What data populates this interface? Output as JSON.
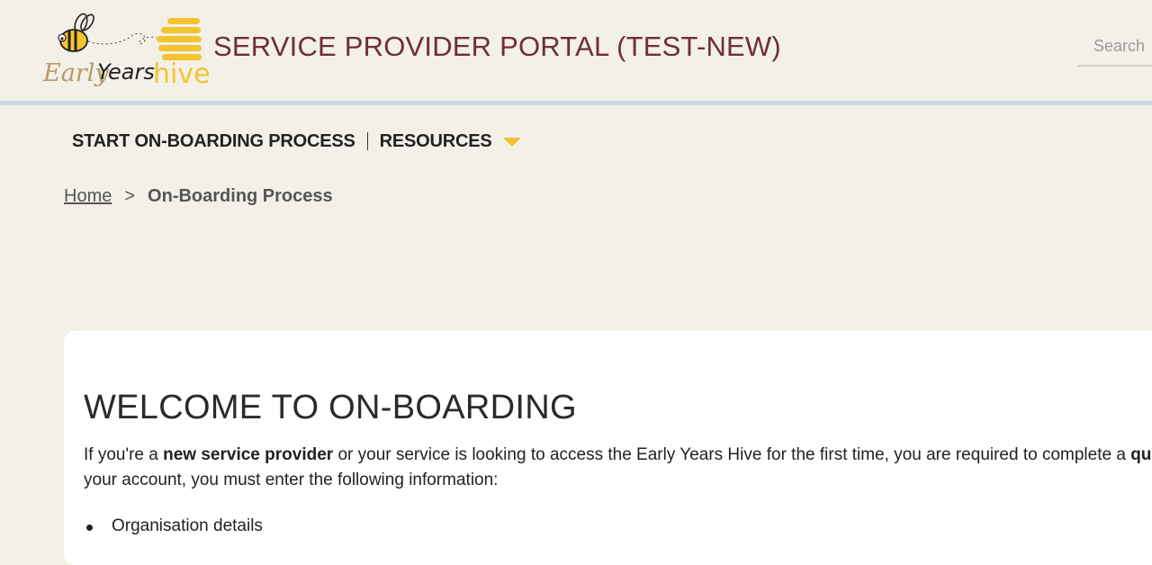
{
  "header": {
    "logo_text_early": "Early",
    "logo_text_years": "Years",
    "logo_text_hive": "hive",
    "title": "SERVICE PROVIDER PORTAL (TEST-NEW)",
    "search_placeholder": "Search"
  },
  "nav": {
    "items": [
      {
        "label": "START ON-BOARDING PROCESS"
      },
      {
        "label": "RESOURCES"
      }
    ]
  },
  "breadcrumb": {
    "home": "Home",
    "separator": ">",
    "current": "On-Boarding Process"
  },
  "content": {
    "heading": "WELCOME TO ON-BOARDING",
    "intro_part1": "If you're a ",
    "intro_bold1": "new service provider",
    "intro_part2": " or your service is looking to access the Early Years Hive for the first time, you are required to complete a ",
    "intro_bold2": "quick",
    "intro_part3": " your account, you must enter the following information:",
    "list": [
      "Organisation details"
    ]
  },
  "colors": {
    "background": "#f3f0e8",
    "title": "#6e2f37",
    "accent_yellow": "#f4c430",
    "rule": "#ccd6e2"
  }
}
